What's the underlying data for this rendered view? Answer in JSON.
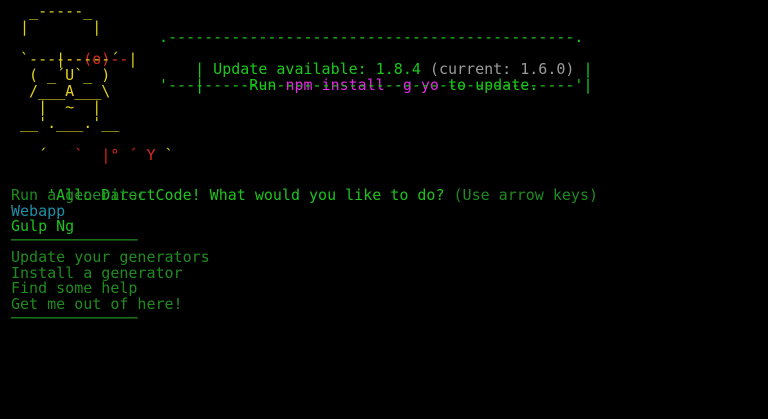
{
  "logo": {
    "line1": "  _-----_",
    "line2": " |       |",
    "line3a": " |",
    "line3b": "--(o)--",
    "line3c": "|",
    "line4": " `---------´",
    "line5": "  ( _´U`_ )",
    "line6": "  /___A___\\",
    "line7": "   |  ~  |",
    "line8": " __'.___.'__",
    "line9a": "´",
    "line9b": "   `  |° ´ Y",
    "line9c": " `"
  },
  "update_box": {
    "top": ".---------------------------------------------.",
    "bottom": "'---------------------------------------------'",
    "l1_pre": "| Update available: ",
    "l1_new": "1.8.4",
    "l1_cur": " (current: 1.6.0)",
    "l1_post": " |",
    "l2_pre": "|     Run ",
    "l2_cmd": "npm install -g yo",
    "l2_post": " to update.     |"
  },
  "prompt": {
    "question": "'Allo DirectCode! What would you like to do?",
    "hint": "(Use arrow keys)"
  },
  "menu": {
    "group1": [
      "Run a generator",
      "Webapp",
      "Gulp Ng"
    ],
    "separator": "──────────────",
    "group2": [
      "Update your generators",
      "Install a generator",
      "Find some help",
      "Get me out of here!"
    ]
  },
  "colors": {
    "background": "#000000",
    "green": "#19c919",
    "dim_green": "#1f8b1f",
    "yellow": "#e0d21c",
    "magenta": "#e22ce2",
    "cyan": "#1f8fa6",
    "red": "#e02424"
  }
}
